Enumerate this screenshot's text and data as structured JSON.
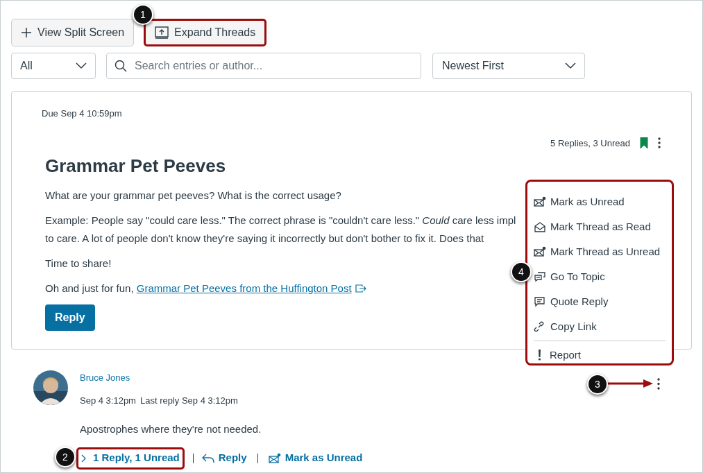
{
  "toolbar": {
    "buttons": [
      {
        "kind": "plus",
        "label": "View Split Screen",
        "highlighted": false
      },
      {
        "kind": "expand",
        "label": "Expand Threads",
        "highlighted": true
      }
    ]
  },
  "filters": {
    "filter": "All",
    "search": {
      "placeholder": "Search entries or author..."
    },
    "sort": "Newest First"
  },
  "topic": {
    "due": "Due Sep 4 10:59pm",
    "reply_count": "5 Replies, 3 Unread",
    "bookmarked": true,
    "title": "Grammar Pet Peeves",
    "paragraphs": [
      [
        "What are your grammar pet peeves? What is the correct usage?"
      ],
      [
        "Example: People say \"could care less.\" The correct phrase is \"couldn't care less.\" *Could* care less impl",
        "to care. A lot of people don't know they're saying it incorrectly but don't bother to fix it. Does that"
      ],
      [
        "Time to share!"
      ]
    ],
    "link_prefix": "Oh and just for fun, ",
    "link": "Grammar Pet Peeves from the Huffington Post",
    "reply_button": "Reply"
  },
  "menu": {
    "items": [
      {
        "kind": "unread",
        "label": "Mark as Unread"
      },
      {
        "kind": "read",
        "label": "Mark Thread as Read"
      },
      {
        "kind": "unread",
        "label": "Mark Thread as Unread"
      },
      {
        "kind": "topic",
        "label": "Go To Topic"
      },
      {
        "kind": "quote",
        "label": "Quote Reply"
      },
      {
        "kind": "link",
        "label": "Copy Link"
      },
      {
        "kind": "report",
        "label": "Report"
      }
    ]
  },
  "entry": {
    "author": "Bruce Jones",
    "posted": "Sep 4 3:12pm",
    "last_reply": "Last reply Sep 4 3:12pm",
    "message": "Apostrophes where they're not needed.",
    "replies": "1 Reply, 1 Unread",
    "reply": "Reply",
    "mark": "Mark as Unread"
  },
  "callouts": [
    "1",
    "2",
    "3",
    "4"
  ]
}
